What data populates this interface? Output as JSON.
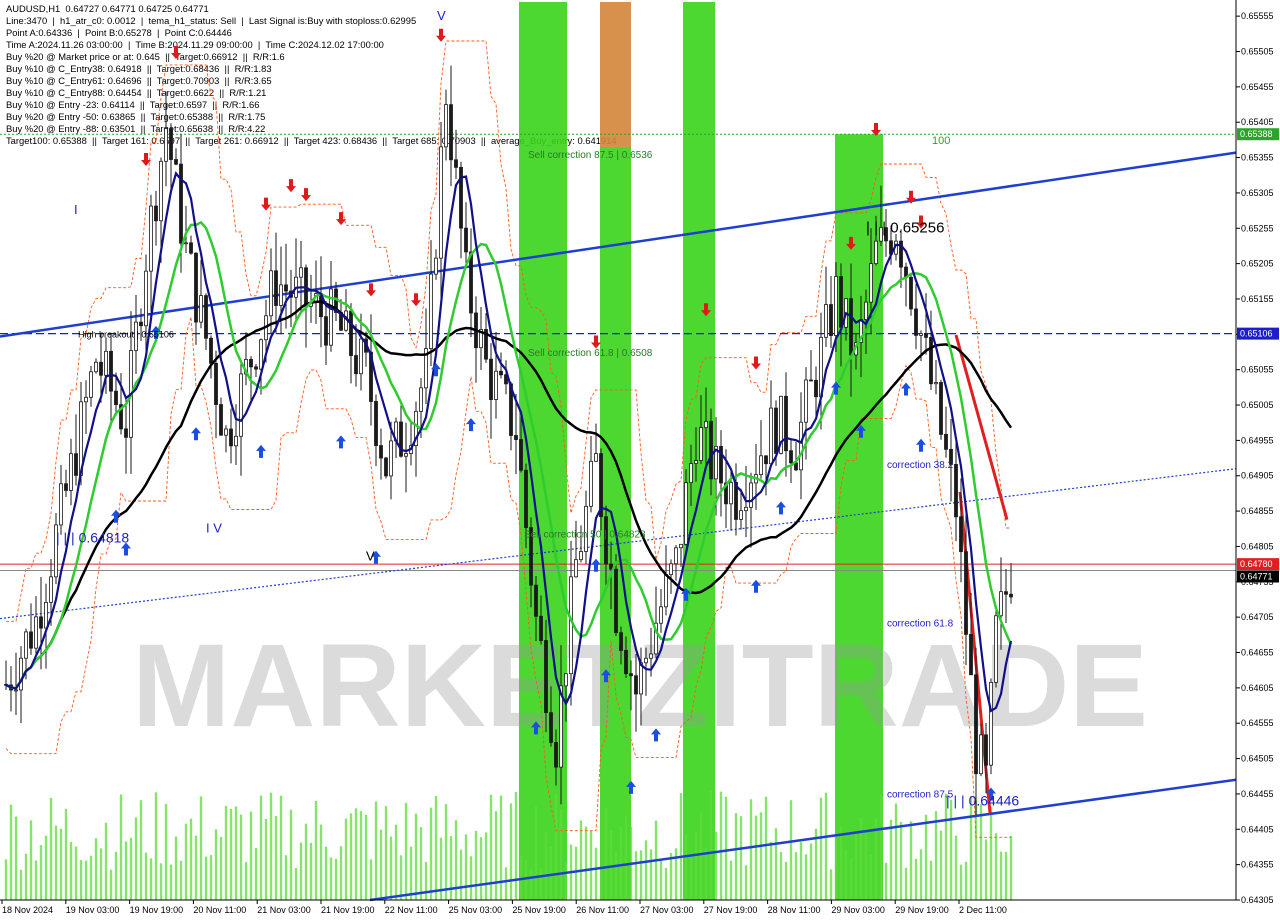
{
  "info_panel": [
    "AUDUSD,H1  0.64727 0.64771 0.64725 0.64771",
    "Line:3470  |  h1_atr_c0: 0.0012  |  tema_h1_status: Sell  |  Last Signal is:Buy with stoploss:0.62995",
    "Point A:0.64336  |  Point B:0.65278  |  Point C:0.64446",
    "Time A:2024.11.26 03:00:00  |  Time B:2024.11.29 09:00:00  |  Time C:2024.12.02 17:00:00",
    "Buy %20 @ Market price or at: 0.645  ||  Target:0.66912  ||  R/R:1.6",
    "Buy %10 @ C_Entry38: 0.64918  ||  Target:0.68436  ||  R/R:1.83",
    "Buy %10 @ C_Entry61: 0.64696  ||  Target:0.70903  ||  R/R:3.65",
    "Buy %10 @ C_Entry88: 0.64454  ||  Target:0.6622  ||  R/R:1.21",
    "Buy %10 @ Entry -23: 0.64114  ||  Target:0.6597  ||  R/R:1.66",
    "Buy %20 @ Entry -50: 0.63865  ||  Target:0.65388  ||  R/R:1.75",
    "Buy %20 @ Entry -88: 0.63501  ||  Target:0.65638  ||  R/R:4.22",
    "Target100: 0.65388  ||  Target 161: 0.6597  ||  Target 261: 0.66912  ||  Target 423: 0.68436  ||  Target 685: 0.70903  ||  average_Buy_entry: 0.641914"
  ],
  "chart_data": {
    "type": "candlestick",
    "symbol": "AUDUSD,H1",
    "ylim": [
      0.64305,
      0.65575
    ],
    "y_ticks": [
      "0.65555",
      "0.65505",
      "0.65455",
      "0.65405",
      "0.65355",
      "0.65305",
      "0.65255",
      "0.65205",
      "0.65155",
      "0.65105",
      "0.65055",
      "0.65005",
      "0.64955",
      "0.64905",
      "0.64855",
      "0.64805",
      "0.64755",
      "0.64705",
      "0.64655",
      "0.64605",
      "0.64555",
      "0.64505",
      "0.64455",
      "0.64405",
      "0.64355",
      "0.64305"
    ],
    "x_ticks": [
      "18 Nov 2024",
      "19 Nov 03:00",
      "19 Nov 19:00",
      "20 Nov 11:00",
      "21 Nov 03:00",
      "21 Nov 19:00",
      "22 Nov 11:00",
      "25 Nov 03:00",
      "25 Nov 19:00",
      "26 Nov 11:00",
      "27 Nov 03:00",
      "27 Nov 19:00",
      "28 Nov 11:00",
      "29 Nov 03:00",
      "29 Nov 19:00",
      "2 Dec 11:00"
    ],
    "price_tags": [
      {
        "label": "0.65388",
        "value": 0.65388,
        "color": "#2aa52a"
      },
      {
        "label": "0.65106",
        "value": 0.65106,
        "color": "#1d1dcc"
      },
      {
        "label": "0.64780",
        "value": 0.6478,
        "color": "#e02020"
      },
      {
        "label": "0.64771",
        "value": 0.64771,
        "color": "#000000"
      }
    ],
    "annotations": [
      {
        "text": "| | | 0.65256",
        "color": "#000000"
      },
      {
        "text": "| | | 0.64818",
        "color": "#1d1dcc"
      },
      {
        "text": "| | | 0.64446",
        "color": "#1d1dcc"
      },
      {
        "text": "100",
        "color": "#2aa52a"
      },
      {
        "text": "Sell correction 87.5 | 0.6536",
        "color": "#2a7a2a"
      },
      {
        "text": "Sell correction 61.8 | 0.6508",
        "color": "#2a7a2a"
      },
      {
        "text": "Sell correction 50 | 0.64823",
        "color": "#2a7a2a"
      },
      {
        "text": "correction 38.2",
        "color": "#1d1dcc"
      },
      {
        "text": "correction 61.8",
        "color": "#1d1dcc"
      },
      {
        "text": "correction 87.5",
        "color": "#1d1dcc"
      },
      {
        "text": "High breakout | 0.65106",
        "color": "#000000"
      },
      {
        "text": "V",
        "color": "#000000"
      },
      {
        "text": "I V",
        "color": "#1d1dcc"
      },
      {
        "text": "I",
        "color": "#1d1dcc"
      },
      {
        "text": "V",
        "color": "#1d1dcc"
      }
    ],
    "watermark": "MARKETZITRADE",
    "colors": {
      "candle": "#1a1a1a",
      "ma_long": "#000000",
      "ma_mid": "#10108a",
      "ma_fast": "#2ecc2e",
      "band": "#ff5a1a",
      "channel": "#1f3fd0",
      "zone_green": "#39d41a",
      "zone_orange": "#d4843a",
      "volume": "#5fdc3a",
      "arrow_buy": "#1a4ee0",
      "arrow_sell": "#e01a1a"
    }
  }
}
